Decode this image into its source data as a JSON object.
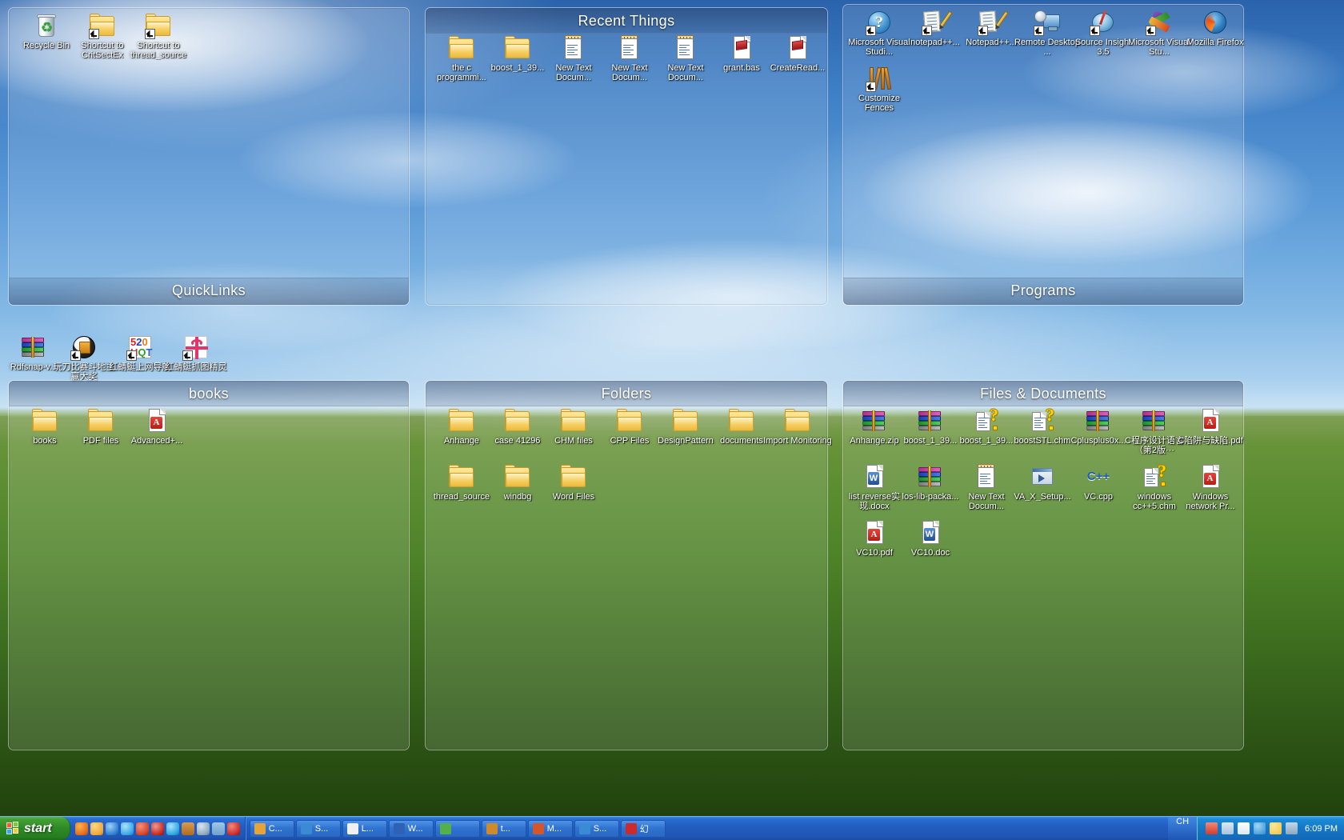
{
  "desktop": {
    "loose_icons": [
      {
        "label": "Rdfsnap-v...",
        "icon": "winrar-archive-icon",
        "shortcut": false
      },
      {
        "label": "玩刀比赛斗地主赢大奖",
        "icon": "game-disc-icon",
        "shortcut": true
      },
      {
        "label": "红蜻蜓上网导航",
        "icon": "520hqt-icon",
        "shortcut": true
      },
      {
        "label": "红蜻蜓抓图精灵",
        "icon": "gift-box-icon",
        "shortcut": true
      }
    ]
  },
  "fences": [
    {
      "id": "quicklinks",
      "title": "QuickLinks",
      "title_position": "bottom",
      "items": [
        {
          "label": "Recycle Bin",
          "icon": "recycle-bin-icon",
          "shortcut": false
        },
        {
          "label": "Shortcut to CritSectEx",
          "icon": "folder-icon",
          "shortcut": true
        },
        {
          "label": "Shortcut to thread_source",
          "icon": "folder-icon",
          "shortcut": true
        }
      ]
    },
    {
      "id": "recent-things",
      "title": "Recent Things",
      "title_position": "top",
      "items": [
        {
          "label": "the c programmi...",
          "icon": "folder-icon",
          "shortcut": false
        },
        {
          "label": "boost_1_39...",
          "icon": "folder-icon",
          "shortcut": false
        },
        {
          "label": "New Text Docum...",
          "icon": "text-document-icon",
          "shortcut": false
        },
        {
          "label": "New Text Docum...",
          "icon": "text-document-icon",
          "shortcut": false
        },
        {
          "label": "New Text Docum...",
          "icon": "text-document-icon",
          "shortcut": false
        },
        {
          "label": "grant.bas",
          "icon": "basic-source-icon",
          "shortcut": false
        },
        {
          "label": "CreateRead...",
          "icon": "basic-source-icon",
          "shortcut": false
        }
      ]
    },
    {
      "id": "programs",
      "title": "Programs",
      "title_position": "bottom",
      "items": [
        {
          "label": "Microsoft Visual Studi...",
          "icon": "visual-studio-help-icon",
          "shortcut": true
        },
        {
          "label": "notepad++...",
          "icon": "notepad-plus-plus-icon",
          "shortcut": true
        },
        {
          "label": "Notepad++...",
          "icon": "notepad-plus-plus-icon",
          "shortcut": true
        },
        {
          "label": "Remote Desktop ...",
          "icon": "remote-desktop-icon",
          "shortcut": true
        },
        {
          "label": "Source Insight 3.5",
          "icon": "source-insight-icon",
          "shortcut": true
        },
        {
          "label": "Microsoft Visual Stu...",
          "icon": "visual-studio-icon",
          "shortcut": true
        },
        {
          "label": "Mozilla Firefox",
          "icon": "firefox-icon",
          "shortcut": false
        },
        {
          "label": "Customize Fences",
          "icon": "fences-icon",
          "shortcut": true
        }
      ]
    },
    {
      "id": "books",
      "title": "books",
      "title_position": "top",
      "items": [
        {
          "label": "books",
          "icon": "folder-icon",
          "shortcut": false
        },
        {
          "label": "PDF files",
          "icon": "folder-icon",
          "shortcut": false
        },
        {
          "label": "Advanced+...",
          "icon": "pdf-icon",
          "shortcut": false
        }
      ]
    },
    {
      "id": "folders",
      "title": "Folders",
      "title_position": "top",
      "items": [
        {
          "label": "Anhange",
          "icon": "folder-icon",
          "shortcut": false
        },
        {
          "label": "case 41296",
          "icon": "folder-icon",
          "shortcut": false
        },
        {
          "label": "CHM files",
          "icon": "folder-icon",
          "shortcut": false
        },
        {
          "label": "CPP Files",
          "icon": "folder-icon",
          "shortcut": false
        },
        {
          "label": "DesignPattern",
          "icon": "folder-icon",
          "shortcut": false
        },
        {
          "label": "documents",
          "icon": "folder-icon",
          "shortcut": false
        },
        {
          "label": "Import Monitoring",
          "icon": "folder-icon",
          "shortcut": false
        },
        {
          "label": "thread_source",
          "icon": "folder-icon",
          "shortcut": false
        },
        {
          "label": "windbg",
          "icon": "folder-icon",
          "shortcut": false
        },
        {
          "label": "Word Files",
          "icon": "folder-icon",
          "shortcut": false
        }
      ]
    },
    {
      "id": "files-documents",
      "title": "Files & Documents",
      "title_position": "top",
      "items": [
        {
          "label": "Anhange.zip",
          "icon": "winrar-archive-icon",
          "shortcut": false
        },
        {
          "label": "boost_1_39...",
          "icon": "winrar-archive-icon",
          "shortcut": false
        },
        {
          "label": "boost_1_39...",
          "icon": "chm-help-icon",
          "shortcut": false
        },
        {
          "label": "boostSTL.chm",
          "icon": "chm-help-icon",
          "shortcut": false
        },
        {
          "label": "Cplusplus0x...",
          "icon": "winrar-archive-icon",
          "shortcut": false
        },
        {
          "label": "C程序设计语言（第2版···",
          "icon": "winrar-archive-icon",
          "shortcut": false
        },
        {
          "label": "C陷阱与缺陷.pdf",
          "icon": "pdf-icon",
          "shortcut": false
        },
        {
          "label": "list reverse实现.docx",
          "icon": "word-doc-icon",
          "shortcut": false
        },
        {
          "label": "los-lib-packa...",
          "icon": "winrar-archive-icon",
          "shortcut": false
        },
        {
          "label": "New Text Docum...",
          "icon": "text-document-icon",
          "shortcut": false
        },
        {
          "label": "VA_X_Setup...",
          "icon": "setup-exe-icon",
          "shortcut": false
        },
        {
          "label": "VC.cpp",
          "icon": "cpp-source-icon",
          "shortcut": false
        },
        {
          "label": "windows cc++5.chm",
          "icon": "chm-help-icon",
          "shortcut": false
        },
        {
          "label": "Windows network Pr...",
          "icon": "pdf-icon",
          "shortcut": false
        },
        {
          "label": "VC10.pdf",
          "icon": "pdf-icon",
          "shortcut": false
        },
        {
          "label": "VC10.doc",
          "icon": "word-doc-icon",
          "shortcut": false
        }
      ]
    }
  ],
  "taskbar": {
    "start_label": "start",
    "quick_launch": [
      {
        "name": "firefox-quick-icon",
        "color": "#e36b1f"
      },
      {
        "name": "browser-quick-icon",
        "color": "#f0a63a"
      },
      {
        "name": "ie-quick-icon",
        "color": "#2e7fd0"
      },
      {
        "name": "media-quick-icon",
        "color": "#3aa6e8"
      },
      {
        "name": "maxthon-quick-icon",
        "color": "#d4432a"
      },
      {
        "name": "opera-quick-icon",
        "color": "#c8281c"
      },
      {
        "name": "skype-quick-icon",
        "color": "#2aa8e0"
      },
      {
        "name": "archive-quick-icon",
        "color": "#b06a20"
      },
      {
        "name": "search-quick-icon",
        "color": "#8fa8bc"
      },
      {
        "name": "desktop-quick-icon",
        "color": "#6fa0cc"
      },
      {
        "name": "chinese-app-quick-icon",
        "color": "#cc2b2b"
      }
    ],
    "tasks": [
      {
        "label": "C...",
        "icon_color": "#e8a33a"
      },
      {
        "label": "S...",
        "icon_color": "#3a8ad4"
      },
      {
        "label": "L...",
        "icon_color": "#f0f0f0"
      },
      {
        "label": "W...",
        "icon_color": "#2f62b4"
      },
      {
        "label": "",
        "icon_color": "#56b04a"
      },
      {
        "label": "t...",
        "icon_color": "#d08a2a"
      },
      {
        "label": "M...",
        "icon_color": "#d4562a"
      },
      {
        "label": "S...",
        "icon_color": "#3a8ad4"
      },
      {
        "label": "幻",
        "icon_color": "#cc2b2b"
      }
    ],
    "language": "CH",
    "tray_icons": [
      {
        "name": "ime-tray-icon",
        "color": "#d43a2a"
      },
      {
        "name": "network-tray-icon",
        "color": "#a8c4dc"
      },
      {
        "name": "volume-tray-icon",
        "color": "#dde8f0"
      },
      {
        "name": "antivirus-tray-icon",
        "color": "#2f8ad0"
      },
      {
        "name": "update-tray-icon",
        "color": "#f0c23a"
      },
      {
        "name": "fences-tray-icon",
        "color": "#8aa8c0"
      }
    ],
    "clock": "6:09 PM"
  }
}
